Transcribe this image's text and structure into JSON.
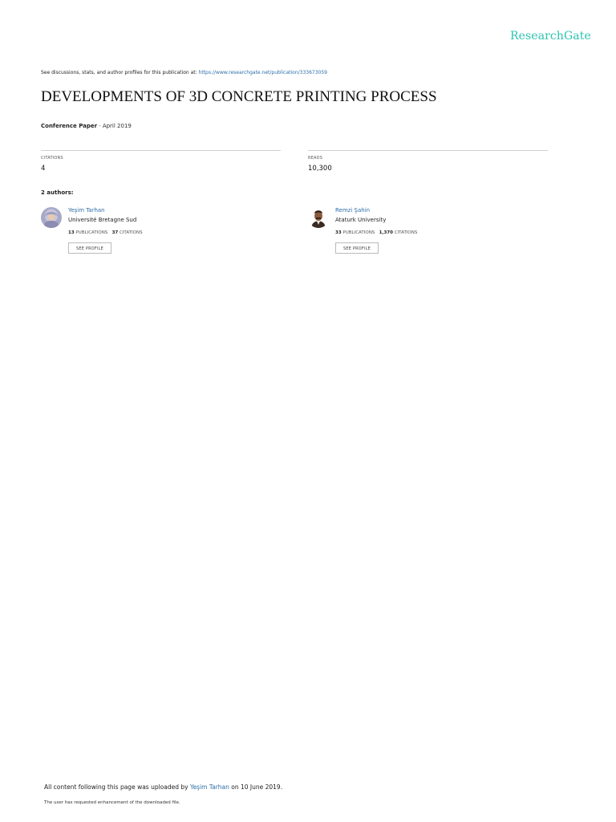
{
  "header": {
    "logo_text": "ResearchGate",
    "see_prefix": "See discussions, stats, and author profiles for this publication at: ",
    "see_url": "https://www.researchgate.net/publication/333673059"
  },
  "paper": {
    "title": "DEVELOPMENTS OF 3D CONCRETE PRINTING PROCESS",
    "type": "Conference Paper",
    "date_sep": " · ",
    "date": "April 2019"
  },
  "stats": {
    "citations_label": "CITATIONS",
    "citations_value": "4",
    "reads_label": "READS",
    "reads_value": "10,300"
  },
  "authors_label": "2 authors:",
  "authors": [
    {
      "name": "Yeşim Tarhan",
      "institution": "Université Bretagne Sud",
      "publications": "13",
      "publications_label": " PUBLICATIONS",
      "citations": "37",
      "citations_label": " CITATIONS",
      "button": "SEE PROFILE"
    },
    {
      "name": "Remzi Şahin",
      "institution": "Ataturk University",
      "publications": "33",
      "publications_label": " PUBLICATIONS",
      "citations": "1,370",
      "citations_label": " CITATIONS",
      "button": "SEE PROFILE"
    }
  ],
  "footer": {
    "uploaded_prefix": "All content following this page was uploaded by ",
    "uploader": "Yeşim Tarhan",
    "uploaded_suffix": " on 10 June 2019.",
    "note": "The user has requested enhancement of the downloaded file."
  },
  "colors": {
    "brand": "#2bc4b0",
    "link": "#2d6ea8",
    "divider": "#cfcfcf"
  }
}
